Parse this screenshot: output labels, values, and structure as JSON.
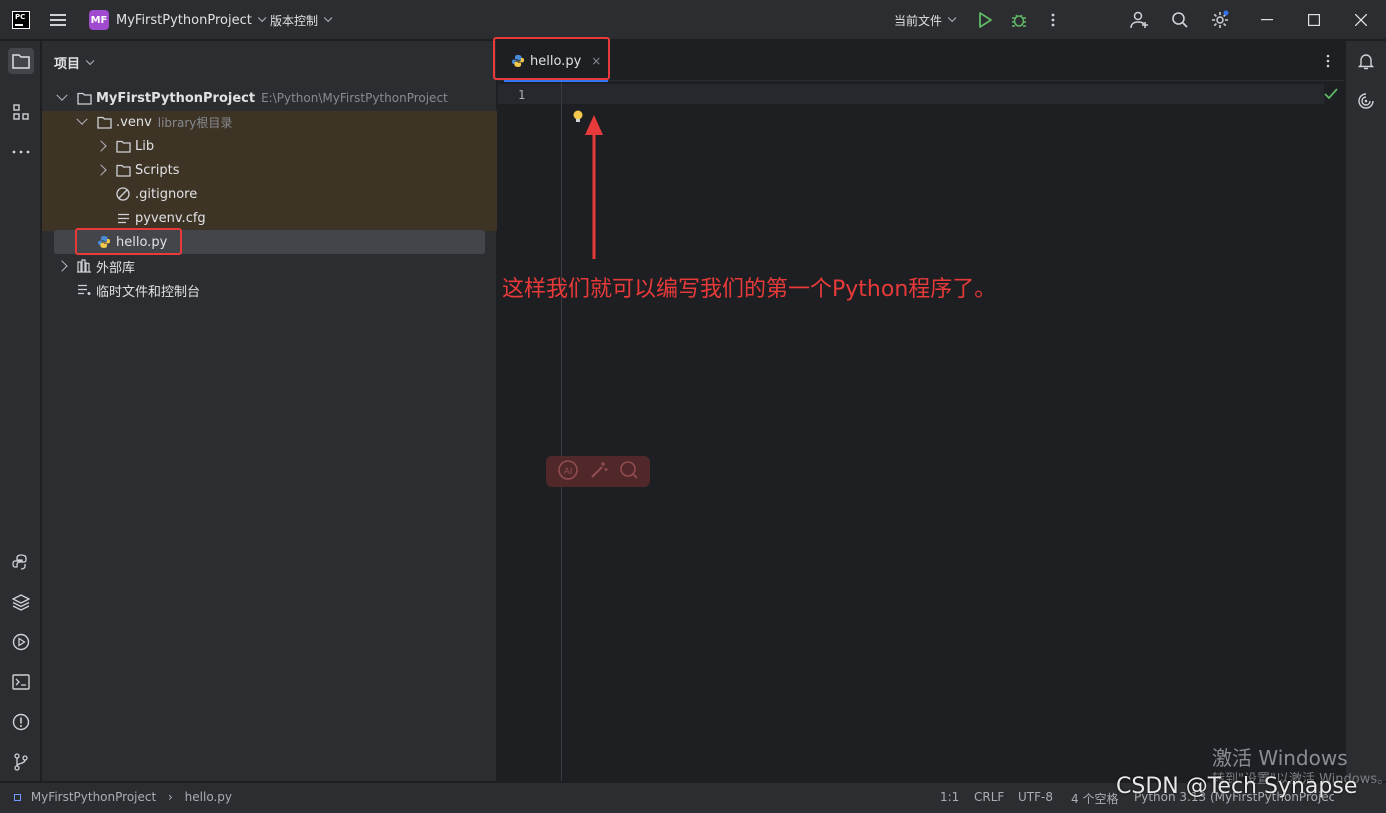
{
  "titlebar": {
    "logo": "PC",
    "project_badge": "MF",
    "project_name": "MyFirstPythonProject",
    "vcs_label": "版本控制",
    "run_config": "当前文件",
    "icons": [
      "hamburger-icon",
      "run-icon",
      "debug-icon",
      "more-vertical-icon",
      "add-user-icon",
      "search-icon",
      "settings-icon",
      "minimize-icon",
      "maximize-icon",
      "close-icon"
    ]
  },
  "project_panel": {
    "header": "项目",
    "tree": {
      "root_name": "MyFirstPythonProject",
      "root_path": "E:\\Python\\MyFirstPythonProject",
      "venv_name": ".venv",
      "venv_hint": "library根目录",
      "lib": "Lib",
      "scripts": "Scripts",
      "gitignore": ".gitignore",
      "pyvenv": "pyvenv.cfg",
      "hello": "hello.py",
      "external_libs": "外部库",
      "scratches": "临时文件和控制台"
    }
  },
  "editor": {
    "tab_label": "hello.py",
    "tab_close": "×",
    "line_number": "1",
    "annotation": "这样我们就可以编写我们的第一个Python程序了。"
  },
  "statusbar": {
    "breadcrumb_project": "MyFirstPythonProject",
    "breadcrumb_file": "hello.py",
    "caret": "1:1",
    "line_sep": "CRLF",
    "encoding": "UTF-8",
    "indent": "4 个空格",
    "interpreter": "Python 3.13 (MyFirstPythonProject)"
  },
  "watermarks": {
    "windows_title": "激活 Windows",
    "windows_sub": "转到\"设置\"以激活 Windows。",
    "csdn": "CSDN @Tech Synapse"
  },
  "colors": {
    "accent": "#3574f0",
    "annotation_red": "#e83a3a",
    "run_green": "#5fb865",
    "venv_highlight": "#3e3426"
  }
}
